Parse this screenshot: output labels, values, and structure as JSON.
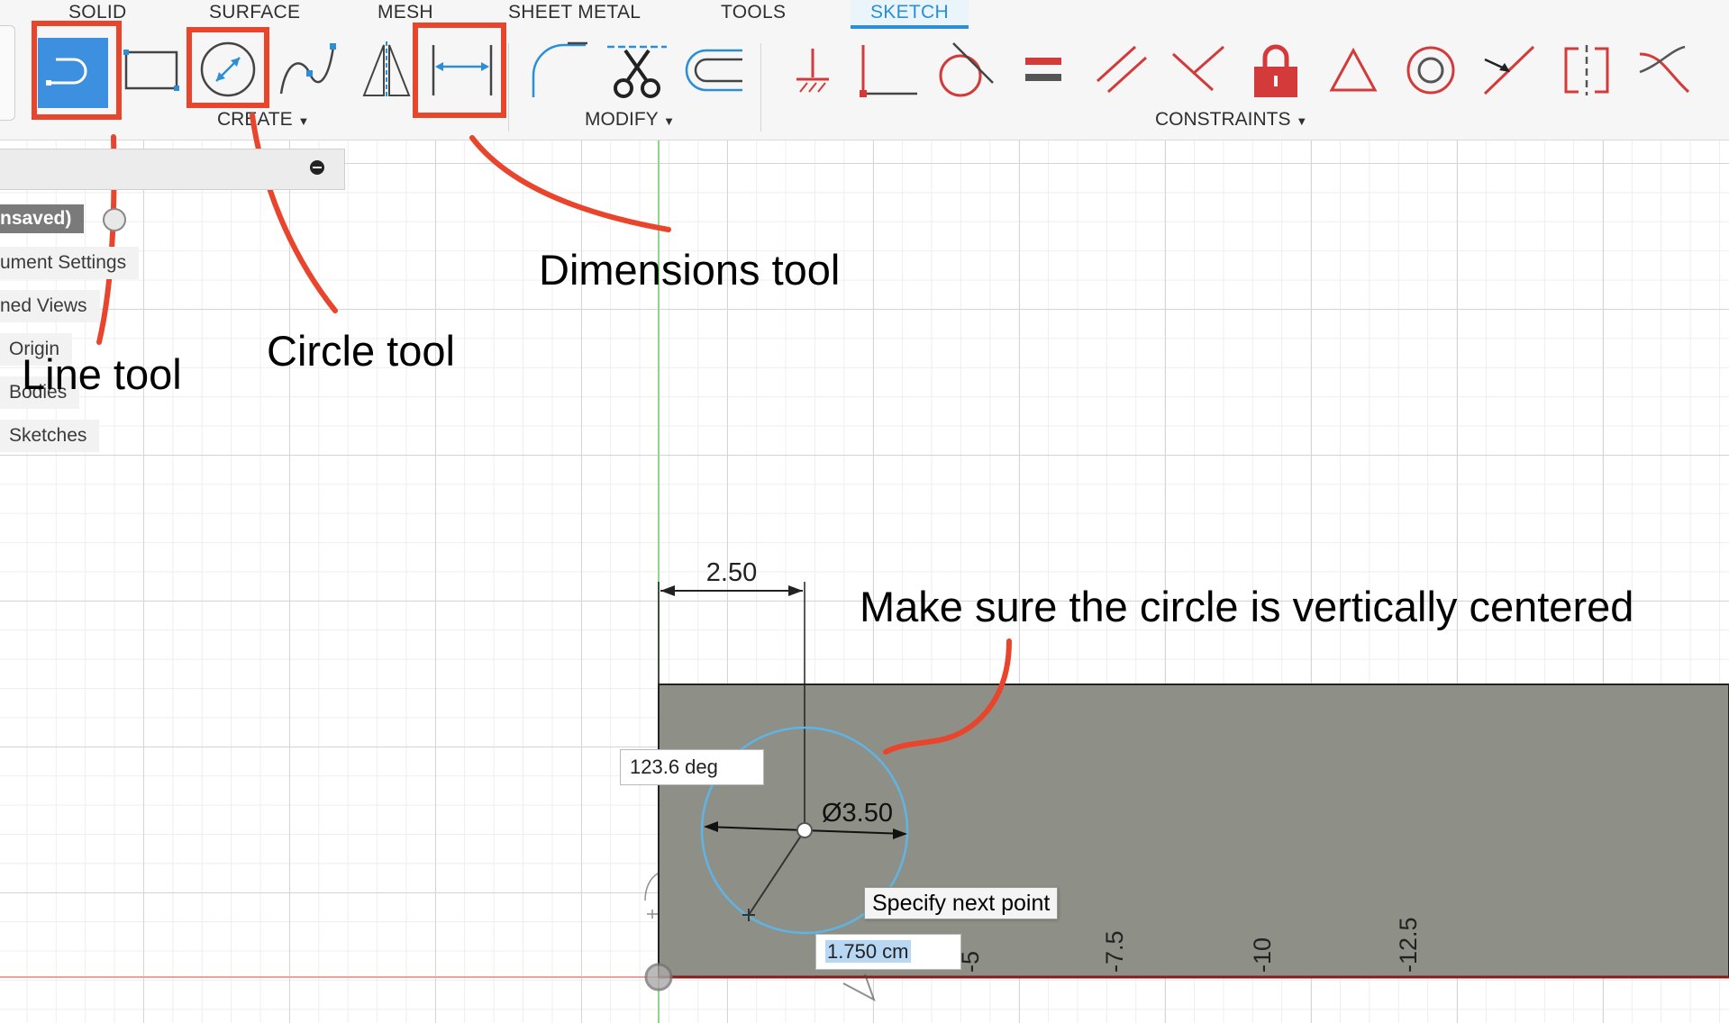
{
  "tabs": [
    {
      "label": "SOLID"
    },
    {
      "label": "SURFACE"
    },
    {
      "label": "MESH"
    },
    {
      "label": "SHEET METAL"
    },
    {
      "label": "TOOLS"
    },
    {
      "label": "SKETCH"
    }
  ],
  "active_tab": "SKETCH",
  "groups": {
    "create": "CREATE",
    "modify": "MODIFY",
    "constraints": "CONSTRAINTS"
  },
  "browser": {
    "root": "nsaved)",
    "items": [
      "ument Settings",
      "ned Views",
      "Origin",
      "Bodies",
      "Sketches"
    ]
  },
  "annotations": {
    "line_tool": "Line tool",
    "circle_tool": "Circle tool",
    "dimensions_tool": "Dimensions tool",
    "center_note": "Make sure the circle is vertically centered"
  },
  "sketch": {
    "dim_width": "2.50",
    "dim_diameter": "Ø3.50",
    "angle_field": "123.6 deg",
    "length_field": "1.750 cm",
    "tooltip": "Specify next point",
    "axis_labels": [
      "-5",
      "-7.5",
      "-10",
      "-12.5"
    ]
  },
  "colors": {
    "accent": "#2a8fd6",
    "annotation_red": "#e8452c",
    "body_fill": "#8e9087",
    "constraint_red": "#d33a3a"
  }
}
